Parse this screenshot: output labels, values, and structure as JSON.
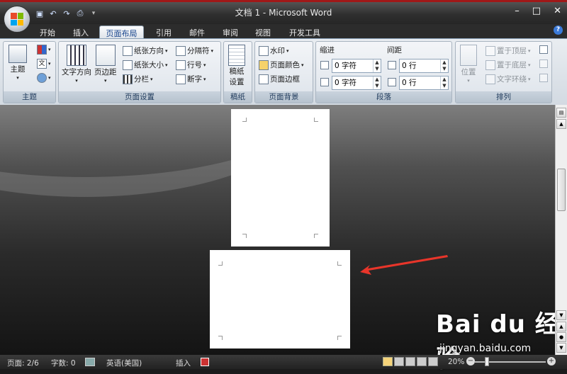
{
  "window": {
    "title": "文档 1 - Microsoft Word",
    "minimize": "–",
    "maximize": "□",
    "close": "✕"
  },
  "qat": [
    "save",
    "undo",
    "redo",
    "print-preview"
  ],
  "tabs": [
    "开始",
    "插入",
    "页面布局",
    "引用",
    "邮件",
    "审阅",
    "视图",
    "开发工具"
  ],
  "active_tab": "页面布局",
  "ribbon": {
    "themes": {
      "caption": "主题",
      "theme_label": "主题"
    },
    "page_setup": {
      "caption": "页面设置",
      "text_direction": "文字方向",
      "margins": "页边距",
      "orientation": "纸张方向",
      "size": "纸张大小",
      "columns": "分栏",
      "breaks": "分隔符",
      "line_numbers": "行号",
      "hyphenation": "断字"
    },
    "draft": {
      "caption": "稿纸",
      "setup_line1": "稿纸",
      "setup_line2": "设置"
    },
    "page_background": {
      "caption": "页面背景",
      "watermark": "水印",
      "page_color": "页面颜色",
      "page_borders": "页面边框"
    },
    "paragraph": {
      "caption": "段落",
      "indent_label": "缩进",
      "spacing_label": "间距",
      "indent_left": "0 字符",
      "indent_right": "0 字符",
      "spacing_before": "0 行",
      "spacing_after": "0 行"
    },
    "arrange": {
      "caption": "排列",
      "position": "位置",
      "bring_front": "置于顶层",
      "send_back": "置于底层",
      "text_wrap": "文字环绕"
    }
  },
  "status": {
    "page": "页面: 2/6",
    "words": "字数: 0",
    "language": "英语(美国)",
    "insert_mode": "插入",
    "zoom": "20%"
  },
  "watermark": {
    "brand": "Bai du 经验",
    "url": "jingyan.baidu.com"
  },
  "colors": {
    "accent": "#15428b",
    "arrow": "#e8352a",
    "status_bar": "#2a2a2a"
  }
}
